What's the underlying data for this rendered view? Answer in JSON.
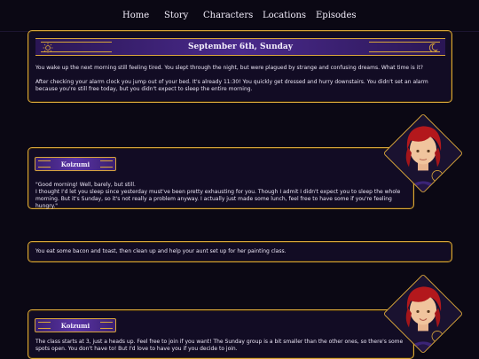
{
  "nav": {
    "items": [
      "Home",
      "Story",
      "Characters",
      "Locations",
      "Episodes"
    ]
  },
  "intro": {
    "date": "September 6th, Sunday",
    "paragraphs": [
      "You wake up the next morning still feeling tired. You slept through the night, but were plagued by strange and confusing dreams. What time is it?",
      "After checking your alarm clock you jump out of your bed. It's already 11:30! You quickly get dressed and hurry downstairs. You didn't set an alarm because you're still free today, but you didn't expect to sleep the entire morning."
    ]
  },
  "dialogue1": {
    "speaker": "Koizumi",
    "lines": [
      "\"Good morning! Well, barely, but still.",
      "I thought I'd let you sleep since yesterday must've been pretty exhausting for you. Though I admit I didn't expect you to sleep the whole morning. But it's Sunday, so it's not really a problem anyway. I actually just made some lunch, feel free to have some if you're feeling hungry.\""
    ]
  },
  "narration2": {
    "text": "You eat some bacon and toast, then clean up and help your aunt set up for her painting class."
  },
  "dialogue2": {
    "speaker": "Koizumi",
    "lines": [
      "The class starts at 3, just a heads up. Feel free to join if you want! The Sunday group is a bit smaller than the other ones, so there's some spots open. You don't have to! But I'd love to have you if you decide to join."
    ]
  },
  "colors": {
    "accent": "#d9a63a",
    "panel": "#120c24",
    "banner": "#4a2a8c",
    "background": "#0b0814"
  }
}
